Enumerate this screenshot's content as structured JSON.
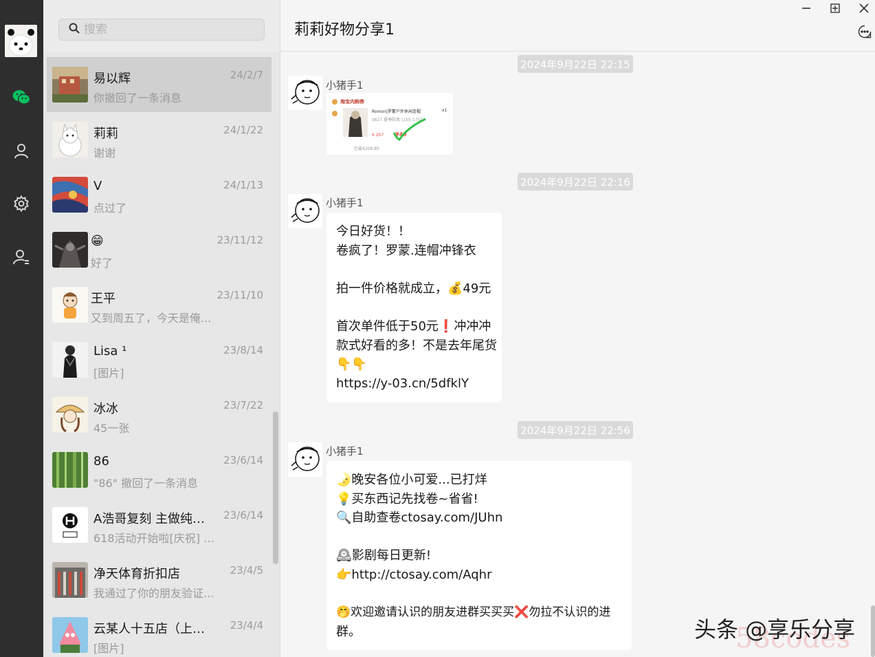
{
  "search": {
    "placeholder": "搜索"
  },
  "conversations": [
    {
      "name": "易以辉",
      "preview": "你撤回了一条消息",
      "time": "24/2/7"
    },
    {
      "name": "莉莉",
      "preview": "谢谢",
      "time": "24/1/22"
    },
    {
      "name": "V",
      "preview": "点过了",
      "time": "24/1/13"
    },
    {
      "name": "😁",
      "preview": "好了",
      "time": "23/11/12"
    },
    {
      "name": "王平",
      "preview": "又到周五了，今天是俺...",
      "time": "23/11/10"
    },
    {
      "name": "Lisa ¹",
      "preview": "[图片]",
      "time": "23/8/14"
    },
    {
      "name": "冰冰",
      "preview": "45一张",
      "time": "23/7/22"
    },
    {
      "name": "86",
      "preview": "\"86\" 撤回了一条消息",
      "time": "23/6/14"
    },
    {
      "name": "A浩哥复刻 主做纯原...",
      "preview": "618活动开始啦[庆祝] 简...",
      "time": "23/6/14"
    },
    {
      "name": "净天体育折扣店",
      "preview": "我通过了你的朋友验证...",
      "time": "23/4/5"
    },
    {
      "name": "云某人十五店（上班...",
      "preview": "[图片]",
      "time": "23/4/4"
    }
  ],
  "chat": {
    "title": "莉莉好物分享1",
    "messages": [
      {
        "timestamp": "2024年9月22日 22:15",
        "sender": "小猪手1",
        "type": "image",
        "image": {
          "shop": "淘宝内购券",
          "product": "Romon|罗蒙户外休闲连帽",
          "qty": "x1",
          "size": "S627 夏季防风 [155-175]",
          "price_old": "¥.207",
          "price_new": "¥49",
          "note": "已省¥208.80"
        }
      },
      {
        "timestamp": "2024年9月22日 22:16",
        "sender": "小猪手1",
        "type": "text",
        "lines": [
          "今日好货！！",
          "卷疯了！罗蒙.连帽冲锋衣",
          "",
          "拍一件价格就成立，💰49元",
          "",
          "首次单件低于50元❗冲冲冲",
          "款式好看的多！不是去年尾货",
          "👇👇",
          "https://y-03.cn/5dfklY"
        ]
      },
      {
        "timestamp": "2024年9月22日 22:56",
        "sender": "小猪手1",
        "type": "text",
        "lines": [
          "🌛晚安各位小可爱...已打烊",
          "💡买东西记先找卷~省省!",
          "🔍自助查卷ctosay.com/JUhn",
          "",
          "🕰影剧每日更新!",
          "👉http://ctosay.com/Aqhr",
          "",
          "🤭欢迎邀请认识的朋友进群买买买❌勿拉不认识的进",
          "群。"
        ]
      }
    ]
  },
  "watermark": {
    "text": "头条 @享乐分享",
    "faint": "58codes"
  },
  "colors": {
    "nav_bg": "#2e2e2e",
    "wechat_green": "#07c160",
    "list_bg": "#e7e7e7",
    "active_item": "#d0d0d0",
    "chat_bg": "#f5f5f5"
  },
  "icons": {
    "nav": [
      "chat-icon",
      "contacts-icon",
      "settings-icon",
      "user-switch-icon"
    ],
    "window": [
      "minimize-icon",
      "maximize-icon",
      "close-icon"
    ],
    "chat": [
      "more-icon"
    ]
  }
}
